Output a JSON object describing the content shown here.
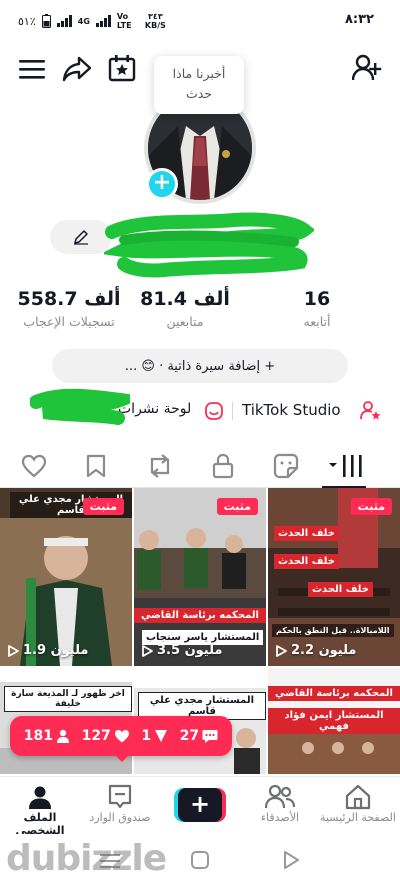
{
  "status_bar": {
    "time": "٨:٣٢",
    "battery": "٥١٪",
    "network": "4G",
    "volte": "Vo LTE",
    "speed_value": "٣٤٣",
    "speed_unit": "KB/S"
  },
  "tooltip": {
    "line1": "أخبرنا ماذا",
    "line2": "حدث"
  },
  "stats": [
    {
      "value": "16",
      "label": "أتابعه"
    },
    {
      "value": "81.4 ألف",
      "label": "متابعين"
    },
    {
      "value": "558.7 ألف",
      "label": "تسجيلات الإعجاب"
    }
  ],
  "bio_button": {
    "label": "+ إضافة سيرة ذاتية · 😊 ..."
  },
  "links": {
    "studio": "TikTok Studio",
    "newsletter": "لوحة نشرات"
  },
  "videos": [
    {
      "views": "2.2 مليون",
      "pinned": "مثبت",
      "captions": [
        "خلف الحدث",
        "خلف الحدث",
        "خلف الحدث",
        "اللامبالاة.. قبل النطق بالحكم"
      ]
    },
    {
      "views": "3.5 مليون",
      "pinned": "مثبت",
      "captions": [
        "المحكمه برئاسة القاضي",
        "المستشار ياسر سنجاب"
      ]
    },
    {
      "views": "1.9 مليون",
      "pinned": "مثبت",
      "captions": [
        "المستشار مجدي علي قاسم"
      ]
    },
    {
      "views": "",
      "pinned": "",
      "captions": [
        "المحكمه برئاسة القاضي",
        "المستشار ايمن فؤاد فهمي"
      ]
    },
    {
      "views": "",
      "pinned": "",
      "captions": [
        "المستشار مجدي علي قاسم"
      ]
    },
    {
      "views": "",
      "pinned": "",
      "captions": [
        "اخر ظهور لـ المذيعة سارة خليفة"
      ]
    }
  ],
  "notification": {
    "followers": "181",
    "likes": "127",
    "mentions": "1",
    "comments": "27"
  },
  "bottom_nav": {
    "home": "الصفحة الرئيسية",
    "friends": "الأصدقاء",
    "inbox": "صندوق الوارد",
    "profile": "الملف الشخصي"
  },
  "watermark": "dubizzle",
  "colors": {
    "accent": "#fe2c55",
    "cyan": "#20d5ec",
    "text": "#161823",
    "muted": "#8a8b91"
  }
}
